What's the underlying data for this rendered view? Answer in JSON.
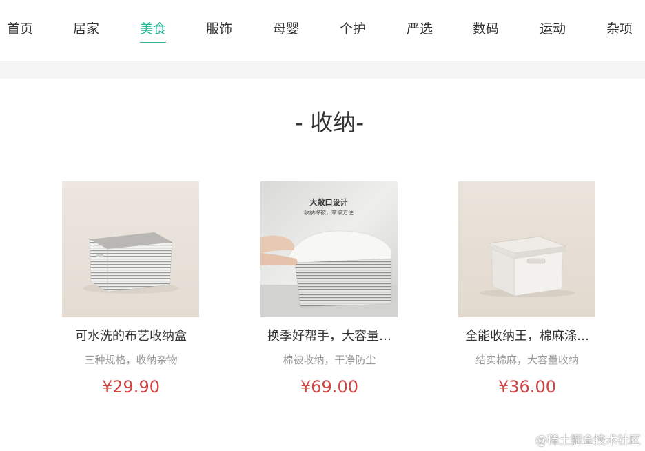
{
  "nav": {
    "items": [
      {
        "label": "首页"
      },
      {
        "label": "居家"
      },
      {
        "label": "美食"
      },
      {
        "label": "服饰"
      },
      {
        "label": "母婴"
      },
      {
        "label": "个护"
      },
      {
        "label": "严选"
      },
      {
        "label": "数码"
      },
      {
        "label": "运动"
      },
      {
        "label": "杂项"
      }
    ],
    "active_label": "美食",
    "active_color": "#27ba9b"
  },
  "section": {
    "title": "- 收纳-"
  },
  "products": [
    {
      "name": "可水洗的布艺收纳盒",
      "desc": "三种规格，收纳杂物",
      "price": "¥29.90"
    },
    {
      "name": "换季好帮手，大容量…",
      "desc": "棉被收纳，干净防尘",
      "price": "¥69.00",
      "image_caption": "大敞口设计",
      "image_subcaption": "收纳棉被，拿取方便"
    },
    {
      "name": "全能收纳王，棉麻涤…",
      "desc": "结实棉麻，大容量收纳",
      "price": "¥36.00"
    }
  ],
  "colors": {
    "price": "#cf4444",
    "text": "#333333",
    "muted": "#999999"
  },
  "watermark": "@稀土掘金技术社区"
}
